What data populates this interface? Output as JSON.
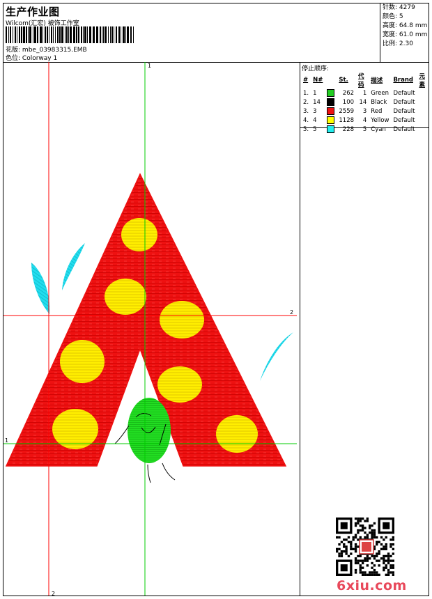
{
  "header": {
    "title": "生产作业图",
    "studio": "Wilcom(汇宏) 被饰工作室",
    "design_label": "花版:",
    "design_file": "mbe_03983315.EMB",
    "colorway_label": "色位:",
    "colorway": "Colorway 1"
  },
  "stats": [
    {
      "label": "针数:",
      "value": "4279"
    },
    {
      "label": "颜色:",
      "value": "5"
    },
    {
      "label": "高度:",
      "value": "64.8 mm"
    },
    {
      "label": "宽度:",
      "value": "61.0 mm"
    },
    {
      "label": "比例:",
      "value": "2.30"
    }
  ],
  "stop_sequence": {
    "title": "停止顺序:",
    "headers": [
      "#",
      "N#",
      "St.",
      "代码",
      "描述",
      "Brand",
      "元素"
    ],
    "rows": [
      {
        "idx": "1.",
        "n": "1",
        "color": "#22cc22",
        "st": "262",
        "code": "1",
        "desc": "Green",
        "brand": "Default"
      },
      {
        "idx": "2.",
        "n": "14",
        "color": "#000000",
        "st": "100",
        "code": "14",
        "desc": "Black",
        "brand": "Default"
      },
      {
        "idx": "3.",
        "n": "3",
        "color": "#ee1111",
        "st": "2559",
        "code": "3",
        "desc": "Red",
        "brand": "Default"
      },
      {
        "idx": "4.",
        "n": "4",
        "color": "#ffff00",
        "st": "1128",
        "code": "4",
        "desc": "Yellow",
        "brand": "Default"
      },
      {
        "idx": "5.",
        "n": "5",
        "color": "#22eeee",
        "st": "228",
        "code": "5",
        "desc": "Cyan",
        "brand": "Default"
      }
    ]
  },
  "guides": {
    "green_label": "1",
    "red_label": "2"
  },
  "colors": {
    "red_thread": "#ee1111",
    "yellow_thread": "#ffee00",
    "green_thread": "#22dd22",
    "cyan_thread": "#22ddee",
    "guide_red": "#ff0000",
    "guide_green": "#00cc00"
  },
  "watermark": "6xiu.com"
}
